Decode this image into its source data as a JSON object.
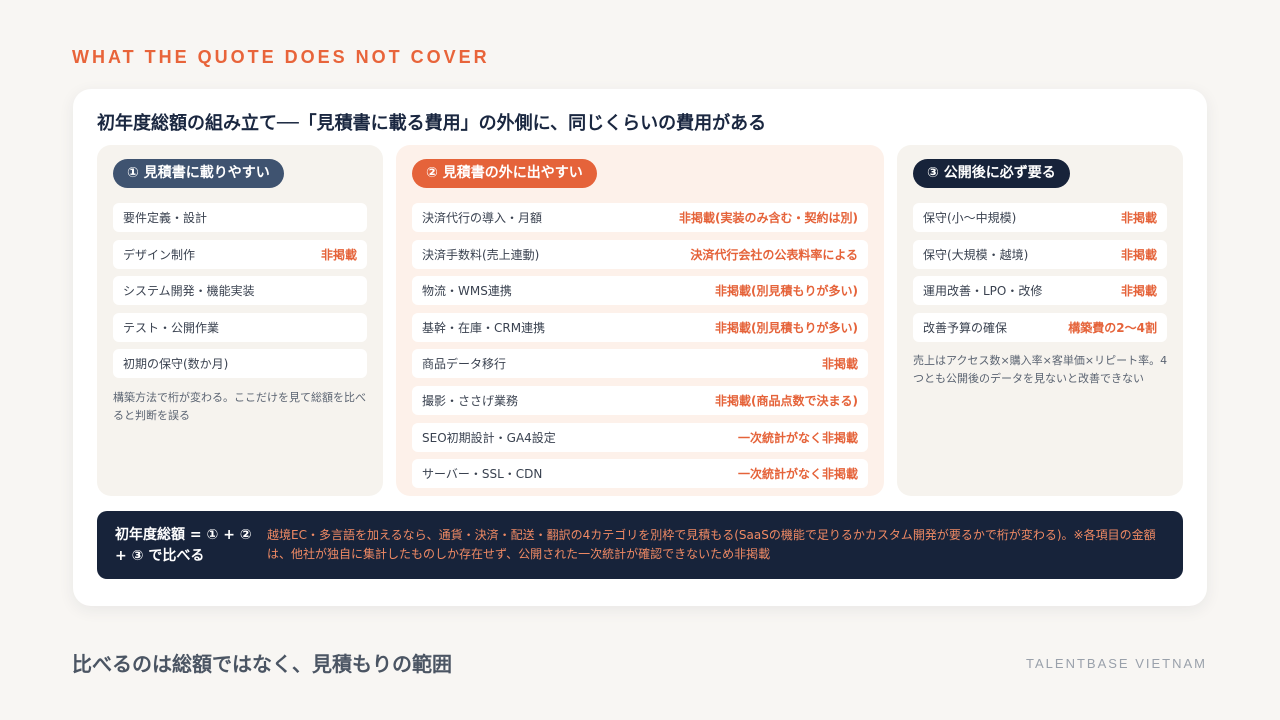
{
  "eyebrow": "WHAT THE QUOTE DOES NOT COVER",
  "card_title": "初年度総額の組み立て──「見積書に載る費用」の外側に、同じくらいの費用がある",
  "columns": [
    {
      "badge": "① 見積書に載りやすい",
      "rows": [
        {
          "label": "要件定義・設計",
          "note": ""
        },
        {
          "label": "デザイン制作",
          "note": "非掲載"
        },
        {
          "label": "システム開発・機能実装",
          "note": ""
        },
        {
          "label": "テスト・公開作業",
          "note": ""
        },
        {
          "label": "初期の保守(数か月)",
          "note": ""
        }
      ],
      "footnote": "構築方法で桁が変わる。ここだけを見て総額を比べると判断を誤る"
    },
    {
      "badge": "② 見積書の外に出やすい",
      "rows": [
        {
          "label": "決済代行の導入・月額",
          "note": "非掲載(実装のみ含む・契約は別)"
        },
        {
          "label": "決済手数料(売上連動)",
          "note": "決済代行会社の公表料率による"
        },
        {
          "label": "物流・WMS連携",
          "note": "非掲載(別見積もりが多い)"
        },
        {
          "label": "基幹・在庫・CRM連携",
          "note": "非掲載(別見積もりが多い)"
        },
        {
          "label": "商品データ移行",
          "note": "非掲載"
        },
        {
          "label": "撮影・ささげ業務",
          "note": "非掲載(商品点数で決まる)"
        },
        {
          "label": "SEO初期設計・GA4設定",
          "note": "一次統計がなく非掲載"
        },
        {
          "label": "サーバー・SSL・CDN",
          "note": "一次統計がなく非掲載"
        }
      ]
    },
    {
      "badge": "③ 公開後に必ず要る",
      "rows": [
        {
          "label": "保守(小〜中規模)",
          "note": "非掲載"
        },
        {
          "label": "保守(大規模・越境)",
          "note": "非掲載"
        },
        {
          "label": "運用改善・LPO・改修",
          "note": "非掲載"
        },
        {
          "label": "改善予算の確保",
          "note": "構築費の2〜4割"
        }
      ],
      "footnote": "売上はアクセス数×購入率×客単価×リピート率。4つとも公開後のデータを見ないと改善できない"
    }
  ],
  "banner": {
    "label": "初年度総額 = ① + ② + ③ で比べる",
    "text": "越境EC・多言語を加えるなら、通貨・決済・配送・翻訳の4カテゴリを別枠で見積もる(SaaSの機能で足りるかカスタム開発が要るかで桁が変わる)。※各項目の金額は、他社が独自に集計したものしか存在せず、公開された一次統計が確認できないため非掲載"
  },
  "headline": "比べるのは総額ではなく、見積もりの範囲",
  "brand": "TALENTBASE VIETNAM",
  "colors": {
    "accent": "#e5633a",
    "navy": "#17233a",
    "slate": "#3f5370"
  }
}
